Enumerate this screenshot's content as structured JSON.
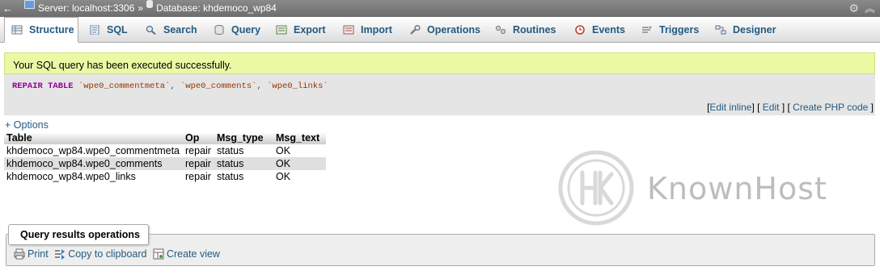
{
  "breadcrumb": {
    "server": "Server: localhost:3306",
    "separator": "»",
    "database": "Database: khdemoco_wp84"
  },
  "tabs": [
    {
      "label": "Structure",
      "icon": "structure-icon",
      "active": true
    },
    {
      "label": "SQL",
      "icon": "sql-icon",
      "active": false
    },
    {
      "label": "Search",
      "icon": "search-icon",
      "active": false
    },
    {
      "label": "Query",
      "icon": "query-icon",
      "active": false
    },
    {
      "label": "Export",
      "icon": "export-icon",
      "active": false
    },
    {
      "label": "Import",
      "icon": "import-icon",
      "active": false
    },
    {
      "label": "Operations",
      "icon": "wrench-icon",
      "active": false
    },
    {
      "label": "Routines",
      "icon": "routines-icon",
      "active": false
    },
    {
      "label": "Events",
      "icon": "clock-icon",
      "active": false
    },
    {
      "label": "Triggers",
      "icon": "triggers-icon",
      "active": false
    },
    {
      "label": "Designer",
      "icon": "designer-icon",
      "active": false
    }
  ],
  "message": {
    "success": "Your SQL query has been executed successfully."
  },
  "sql": {
    "keyword": "REPAIR TABLE",
    "tables": [
      "`wpe0_commentmeta`",
      "`wpe0_comments`",
      "`wpe0_links`"
    ],
    "links": {
      "edit_inline": "Edit inline",
      "edit": "Edit",
      "create_php": "Create PHP code"
    }
  },
  "options_label": "+ Options",
  "results": {
    "columns": [
      "Table",
      "Op",
      "Msg_type",
      "Msg_text"
    ],
    "rows": [
      [
        "khdemoco_wp84.wpe0_commentmeta",
        "repair",
        "status",
        "OK"
      ],
      [
        "khdemoco_wp84.wpe0_comments",
        "repair",
        "status",
        "OK"
      ],
      [
        "khdemoco_wp84.wpe0_links",
        "repair",
        "status",
        "OK"
      ]
    ]
  },
  "watermark": "KnownHost",
  "query_results_ops": {
    "title": "Query results operations",
    "print": "Print",
    "copy": "Copy to clipboard",
    "create_view": "Create view"
  },
  "colors": {
    "link": "#235a81",
    "success_bg": "#ebf8a4",
    "topbar": "#7a7a7a"
  }
}
